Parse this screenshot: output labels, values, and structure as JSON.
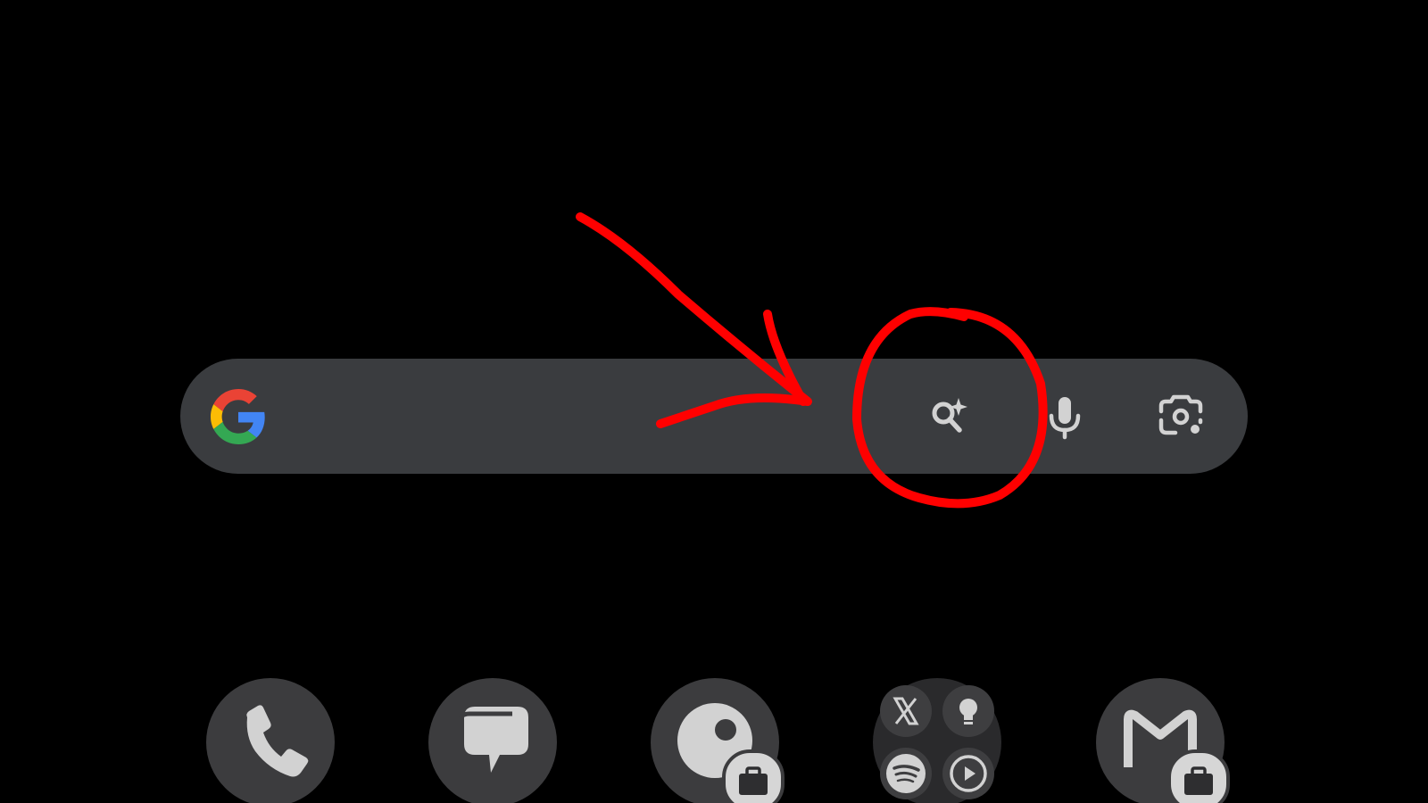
{
  "search_bar": {
    "text": "",
    "logo_icon": "google-g-icon",
    "buttons": [
      {
        "name": "ai-mode-button",
        "icon": "search-sparkle-icon"
      },
      {
        "name": "voice-search-button",
        "icon": "mic-icon"
      },
      {
        "name": "google-lens-button",
        "icon": "camera-lens-icon"
      }
    ]
  },
  "annotation": {
    "arrow_color": "#ff0000",
    "circle_target": "ai-mode-button"
  },
  "dock": {
    "items": [
      {
        "name": "phone",
        "icon": "phone-icon"
      },
      {
        "name": "messages",
        "icon": "message-bubble-icon"
      },
      {
        "name": "chat",
        "icon": "chat-app-icon",
        "badge": "work-briefcase-icon"
      },
      {
        "name": "folder",
        "icons": [
          "x-logo-icon",
          "lightbulb-icon",
          "spotify-icon",
          "play-circle-icon"
        ]
      },
      {
        "name": "gmail",
        "icon": "gmail-m-icon",
        "badge": "work-briefcase-icon"
      }
    ]
  },
  "colors": {
    "background": "#000000",
    "bar": "#3a3c3f",
    "icon": "#d2d2d2",
    "dock_bg": "#3c3c3e",
    "annotation": "#ff0000"
  }
}
